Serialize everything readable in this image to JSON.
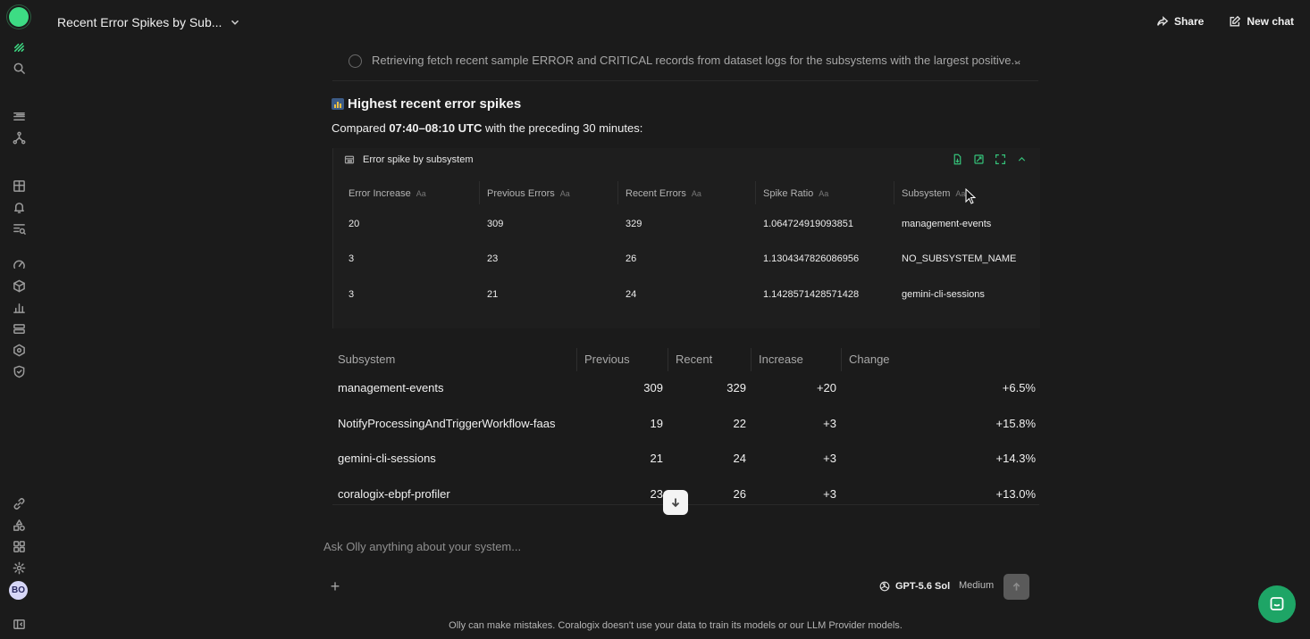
{
  "conversation": {
    "title": "Recent Error Spikes by Sub..."
  },
  "top_actions": {
    "share": "Share",
    "new_chat": "New chat"
  },
  "step": {
    "text": "Retrieving fetch recent sample ERROR and CRITICAL records from dataset logs for the subsystems with the largest positive..."
  },
  "answer": {
    "heading": "Highest recent error spikes",
    "sub_prefix": "Compared",
    "sub_bold": "07:40–08:10 UTC",
    "sub_suffix": "with the preceding 30 minutes:"
  },
  "card": {
    "title": "Error spike by subsystem",
    "headers": [
      "Error Increase",
      "Previous Errors",
      "Recent Errors",
      "Spike Ratio",
      "Subsystem"
    ],
    "type_badge": "Aa",
    "rows": [
      [
        "20",
        "309",
        "329",
        "1.064724919093851",
        "management-events"
      ],
      [
        "3",
        "23",
        "26",
        "1.1304347826086956",
        "NO_SUBSYSTEM_NAME"
      ],
      [
        "3",
        "21",
        "24",
        "1.1428571428571428",
        "gemini-cli-sessions"
      ]
    ]
  },
  "summary_table": {
    "headers": [
      "Subsystem",
      "Previous",
      "Recent",
      "Increase",
      "Change"
    ],
    "rows": [
      [
        "management-events",
        "309",
        "329",
        "+20",
        "+6.5%"
      ],
      [
        "NotifyProcessingAndTriggerWorkflow-faas",
        "19",
        "22",
        "+3",
        "+15.8%"
      ],
      [
        "gemini-cli-sessions",
        "21",
        "24",
        "+3",
        "+14.3%"
      ],
      [
        "coralogix-ebpf-profiler",
        "23",
        "26",
        "+3",
        "+13.0%"
      ]
    ]
  },
  "composer": {
    "placeholder": "Ask Olly anything about your system...",
    "plus": "+",
    "model": "GPT-5.6 Sol",
    "effort": "Medium"
  },
  "disclaimer": "Olly can make mistakes. Coralogix doesn't use your data to train its models or our LLM Provider models.",
  "user": {
    "initials": "BO"
  },
  "colors": {
    "brand": "#3ddc84",
    "fab": "#1ea566",
    "background": "#1b1b1b"
  }
}
